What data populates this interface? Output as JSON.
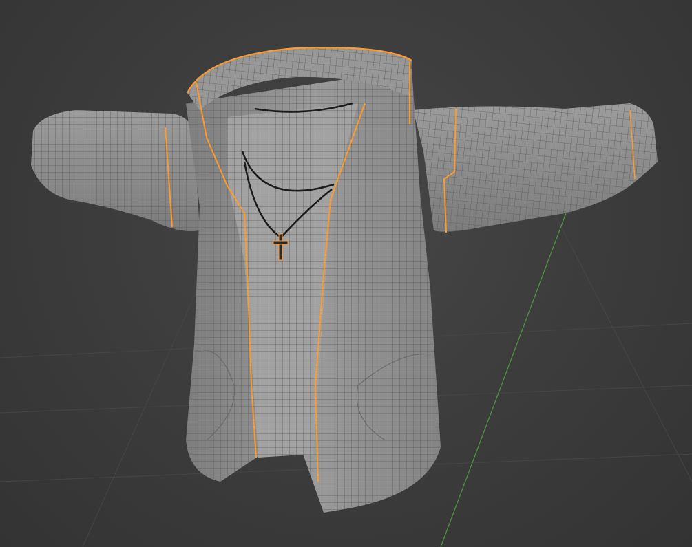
{
  "viewport": {
    "mode": "3D viewport",
    "background_color": "#3d3d3d",
    "grid_color": "#4a4a4a",
    "axis_y_color": "#5aa84a"
  },
  "scene": {
    "object": "hoodie-jacket-mesh",
    "display": "wireframe-overlay",
    "mesh_color": "#8c8c8c",
    "wire_color": "#5a5a5a",
    "selection_outline_color": "#ff9a2a",
    "necklace_color": "#1a1a1a"
  }
}
